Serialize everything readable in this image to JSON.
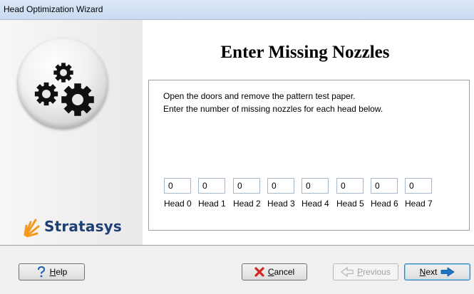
{
  "window": {
    "title": "Head Optimization Wizard"
  },
  "sidebar": {
    "brand": "Stratasys"
  },
  "page": {
    "heading": "Enter Missing Nozzles",
    "instructions": [
      "Open the doors and remove the pattern test paper.",
      "Enter the number of missing nozzles for each head below."
    ],
    "heads": [
      {
        "label": "Head 0",
        "value": "0"
      },
      {
        "label": "Head 1",
        "value": "0"
      },
      {
        "label": "Head 2",
        "value": "0"
      },
      {
        "label": "Head 3",
        "value": "0"
      },
      {
        "label": "Head 4",
        "value": "0"
      },
      {
        "label": "Head 5",
        "value": "0"
      },
      {
        "label": "Head 6",
        "value": "0"
      },
      {
        "label": "Head 7",
        "value": "0"
      }
    ]
  },
  "buttons": {
    "help": {
      "mnemonic": "H",
      "rest": "elp",
      "icon": "question-icon",
      "enabled": true
    },
    "cancel": {
      "mnemonic": "C",
      "rest": "ancel",
      "icon": "red-x-icon",
      "enabled": true
    },
    "previous": {
      "mnemonic": "P",
      "rest": "revious",
      "icon": "left-arrow-icon",
      "enabled": false
    },
    "next": {
      "mnemonic": "N",
      "rest": "ext",
      "icon": "right-arrow-icon",
      "enabled": true
    }
  },
  "colors": {
    "brand_text": "#1d3f73",
    "brand_burst": "#f39a1e",
    "title_bar": "#c9daf0",
    "cancel_x": "#d4261e",
    "next_arrow": "#1a76c9"
  }
}
